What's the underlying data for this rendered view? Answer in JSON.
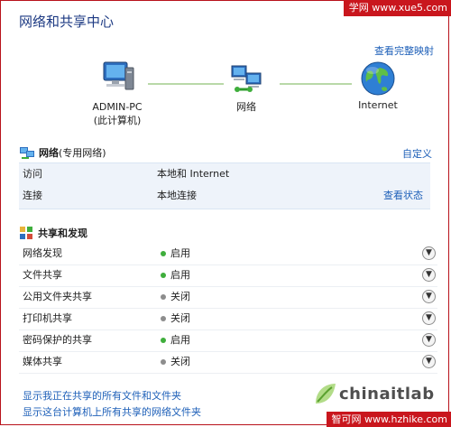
{
  "watermark": {
    "top": "学网 www.xue5.com",
    "bottom": "智可网 www.hzhike.com",
    "logo": "chinaitlab"
  },
  "header": {
    "title": "网络和共享中心",
    "full_map_link": "查看完整映射"
  },
  "map": {
    "computer": {
      "name": "ADMIN-PC",
      "sub": "(此计算机)"
    },
    "network": {
      "name": "网络"
    },
    "internet": {
      "name": "Internet"
    }
  },
  "network_section": {
    "title": "网络",
    "subtitle": " (专用网络)",
    "customize": "自定义",
    "rows": [
      {
        "key": "访问",
        "value": "本地和 Internet",
        "action": ""
      },
      {
        "key": "连接",
        "value": "本地连接",
        "action": "查看状态"
      }
    ]
  },
  "sharing_section": {
    "title": "共享和发现",
    "rows": [
      {
        "key": "网络发现",
        "value": "启用",
        "on": true
      },
      {
        "key": "文件共享",
        "value": "启用",
        "on": true
      },
      {
        "key": "公用文件夹共享",
        "value": "关闭",
        "on": false
      },
      {
        "key": "打印机共享",
        "value": "关闭",
        "on": false
      },
      {
        "key": "密码保护的共享",
        "value": "启用",
        "on": true
      },
      {
        "key": "媒体共享",
        "value": "关闭",
        "on": false
      }
    ]
  },
  "links": {
    "shared_by_me": "显示我正在共享的所有文件和文件夹",
    "shared_on_pc": "显示这台计算机上所有共享的网络文件夹"
  },
  "colors": {
    "on": "#3fae3c",
    "off": "#8d8d8d",
    "link": "#1d5fb8",
    "title": "#1d3a83"
  }
}
